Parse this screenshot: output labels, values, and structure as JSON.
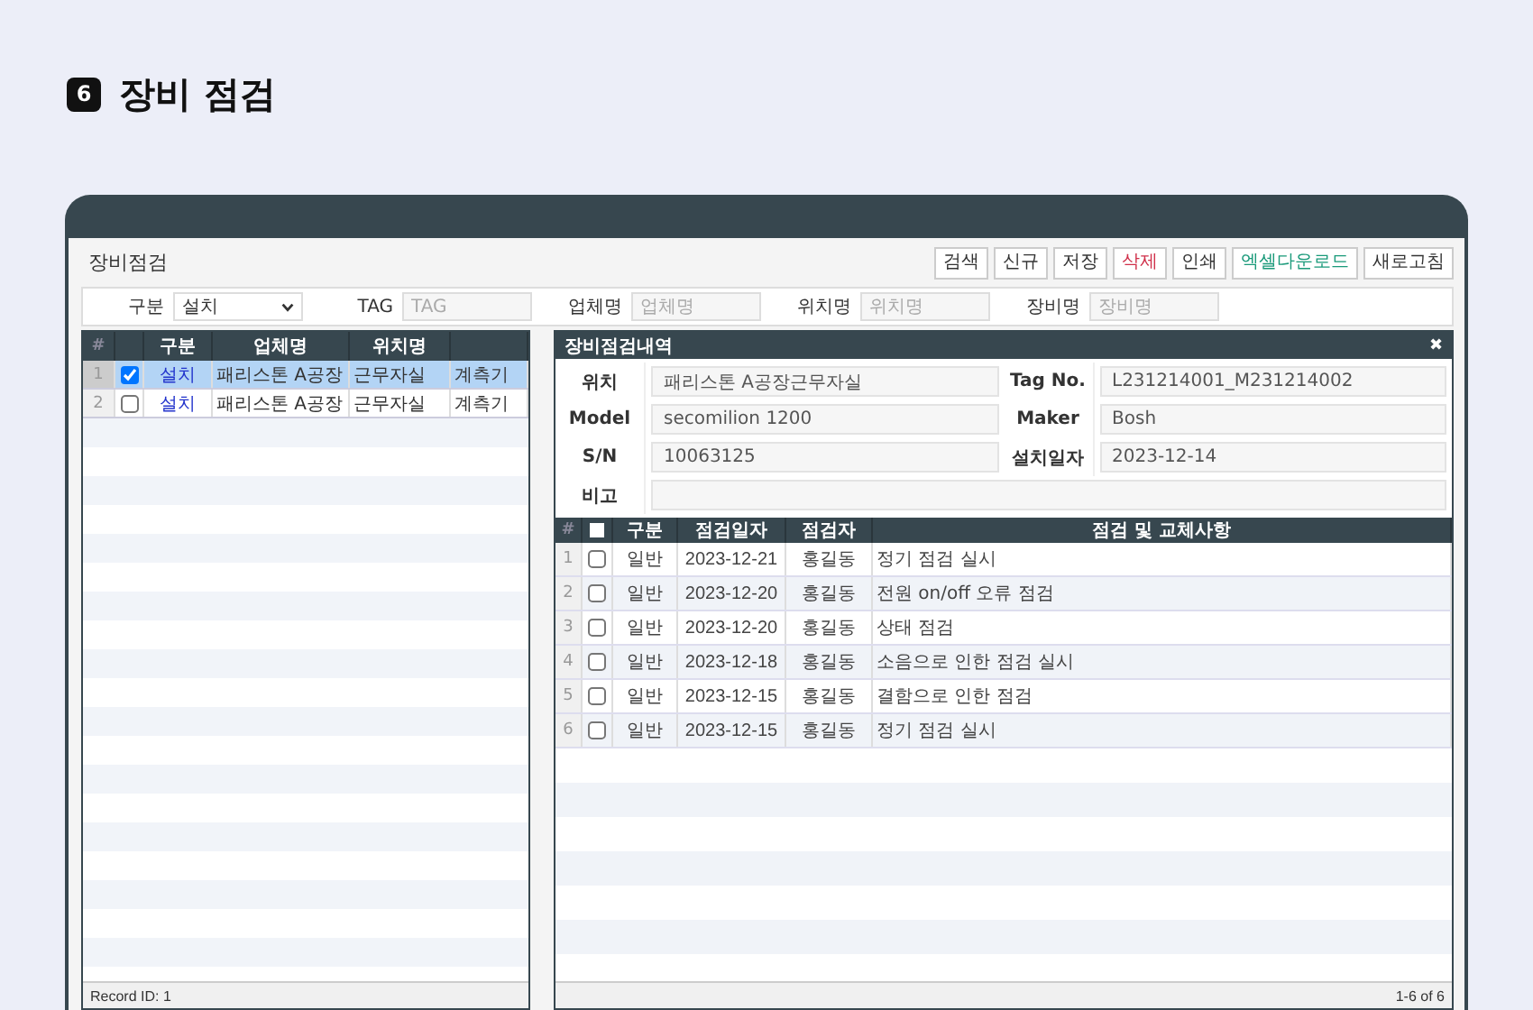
{
  "heading": {
    "number": "6",
    "title": "장비 점검"
  },
  "screen": {
    "title": "장비점검",
    "buttons": [
      {
        "label": "검색",
        "color": "#333333"
      },
      {
        "label": "신규",
        "color": "#333333"
      },
      {
        "label": "저장",
        "color": "#333333"
      },
      {
        "label": "삭제",
        "color": "#d0304a"
      },
      {
        "label": "인쇄",
        "color": "#333333"
      },
      {
        "label": "엑셀다운로드",
        "color": "#1a9a7a"
      },
      {
        "label": "새로고침",
        "color": "#333333"
      }
    ]
  },
  "filters": [
    {
      "label": "구분",
      "kind": "select",
      "value": "설치"
    },
    {
      "label": "TAG",
      "kind": "input",
      "placeholder": "TAG"
    },
    {
      "label": "업체명",
      "kind": "input",
      "placeholder": "업체명"
    },
    {
      "label": "위치명",
      "kind": "input",
      "placeholder": "위치명"
    },
    {
      "label": "장비명",
      "kind": "input",
      "placeholder": "장비명"
    }
  ],
  "left_grid": {
    "header_number": "#",
    "columns": [
      "구분",
      "업체명",
      "위치명"
    ],
    "rows": [
      {
        "number": "1",
        "checked": true,
        "selected": true,
        "category": "설치",
        "company": "패리스톤 A공장",
        "location": "근무자실",
        "column_6": "계측기"
      },
      {
        "number": "2",
        "checked": false,
        "selected": false,
        "category": "설치",
        "company": "패리스톤 A공장",
        "location": "근무자실",
        "column_6": "계측기"
      }
    ],
    "footer": "Record ID: 1"
  },
  "detail": {
    "title": "장비점검내역",
    "close": "✖",
    "fields": [
      {
        "label": "위치",
        "value": "패리스톤 A공장근무자실"
      },
      {
        "label": "Tag No.",
        "value": "L231214001_M231214002"
      },
      {
        "label": "Model",
        "value": "secomilion 1200"
      },
      {
        "label": "Maker",
        "value": "Bosh"
      },
      {
        "label": "S/N",
        "value": "10063125"
      },
      {
        "label": "설치일자",
        "value": "2023-12-14"
      }
    ],
    "remark_label": "비고",
    "table": {
      "header_number": "#",
      "all_checked": false,
      "columns": [
        "구분",
        "점검일자",
        "점검자",
        "점검 및 교체사항"
      ],
      "rows": [
        {
          "number": "1",
          "checked": false,
          "type": "일반",
          "date": "2023-12-21",
          "inspector": "홍길동",
          "content": "정기 점검 실시"
        },
        {
          "number": "2",
          "checked": false,
          "type": "일반",
          "date": "2023-12-20",
          "inspector": "홍길동",
          "content": "전원 on/off 오류 점검"
        },
        {
          "number": "3",
          "checked": false,
          "type": "일반",
          "date": "2023-12-20",
          "inspector": "홍길동",
          "content": "상태 점검"
        },
        {
          "number": "4",
          "checked": false,
          "type": "일반",
          "date": "2023-12-18",
          "inspector": "홍길동",
          "content": "소음으로 인한 점검 실시"
        },
        {
          "number": "5",
          "checked": false,
          "type": "일반",
          "date": "2023-12-15",
          "inspector": "홍길동",
          "content": "결함으로 인한 점검"
        },
        {
          "number": "6",
          "checked": false,
          "type": "일반",
          "date": "2023-12-15",
          "inspector": "홍길동",
          "content": "정기 점검 실시"
        }
      ]
    },
    "footer": "1-6 of 6"
  }
}
